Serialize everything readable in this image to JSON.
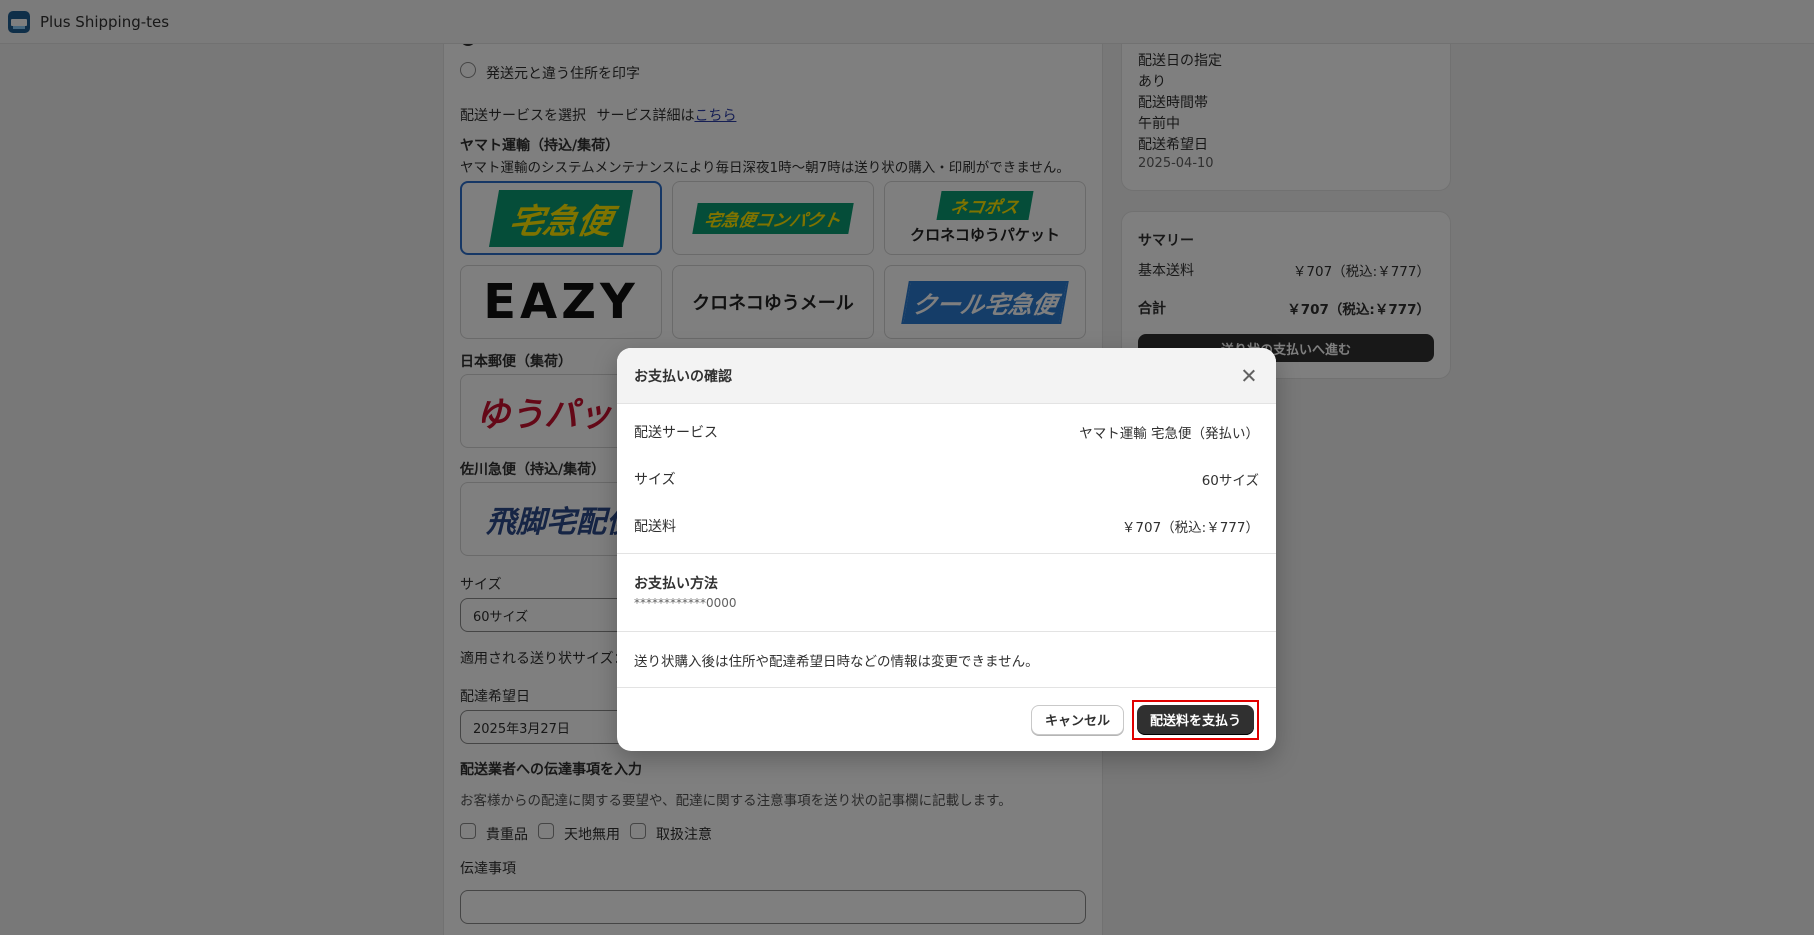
{
  "app": {
    "title": "Plus Shipping-tes"
  },
  "form": {
    "radio_sender_other": "発送元と違う住所を印字",
    "service_select_label": "配送サービスを選択",
    "service_detail_prefix": "サービス詳細は",
    "service_detail_link": "こちら",
    "yamato_heading": "ヤマト運輸（持込/集荷）",
    "yamato_notice": "ヤマト運輸のシステムメンテナンスにより毎日深夜1時〜朝7時は送り状の購入・印刷ができません。",
    "services_yamato": [
      {
        "label": "宅急便",
        "selected": true
      },
      {
        "label": "宅急便コンパクト",
        "selected": false
      },
      {
        "label": "ネコポス",
        "sub": "クロネコゆうパケット",
        "selected": false
      },
      {
        "label": "EAZY",
        "selected": false
      },
      {
        "label": "クロネコゆうメール",
        "selected": false
      },
      {
        "label": "クール宅急便",
        "selected": false
      }
    ],
    "japanpost_heading": "日本郵便（集荷）",
    "japanpost_logo": "ゆうパック",
    "sagawa_heading": "佐川急便（持込/集荷）",
    "sagawa_logo": "飛脚宅配便",
    "size_label": "サイズ",
    "size_value": "60サイズ",
    "applied_label": "適用される送り状サイズ：",
    "delivery_date_label": "配達希望日",
    "delivery_date_value": "2025年3月27日",
    "carrier_note_heading": "配送業者への伝達事項を入力",
    "carrier_note_desc": "お客様からの配達に関する要望や、配達に関する注意事項を送り状の記事欄に記載します。",
    "checkboxes": [
      "貴重品",
      "天地無用",
      "取扱注意"
    ],
    "message_label": "伝達事項"
  },
  "side": {
    "rows": [
      {
        "label": "配送日の指定",
        "value": "あり"
      },
      {
        "label": "配送時間帯",
        "value": "午前中"
      },
      {
        "label": "配送希望日",
        "value": "2025-04-10"
      }
    ],
    "summary_title": "サマリー",
    "base_fee_label": "基本送料",
    "base_fee_value": "￥707（税込:￥777）",
    "total_label": "合計",
    "total_value": "￥707（税込:￥777）",
    "proceed_button": "送り状の支払いへ進む"
  },
  "modal": {
    "title": "お支払いの確認",
    "rows": [
      {
        "label": "配送サービス",
        "value": "ヤマト運輸 宅急便（発払い）"
      },
      {
        "label": "サイズ",
        "value": "60サイズ"
      },
      {
        "label": "配送料",
        "value": "￥707（税込:￥777）"
      }
    ],
    "payment_title": "お支払い方法",
    "payment_card": "************0000",
    "notice": "送り状購入後は住所や配達希望日時などの情報は変更できません。",
    "cancel_label": "キャンセル",
    "pay_label": "配送料を支払う"
  },
  "colors": {
    "highlight": "#e00000",
    "primary": "#303030",
    "selected_border": "#2c6ecb"
  }
}
